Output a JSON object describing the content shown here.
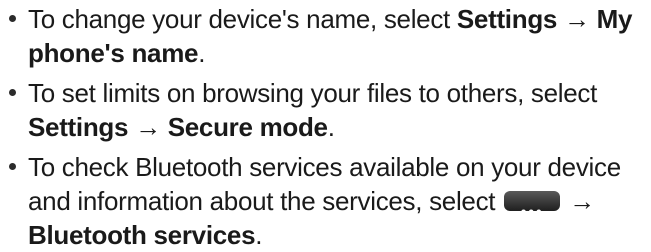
{
  "items": [
    {
      "intro": "To change your device's name, select ",
      "path_1": "Settings",
      "arrow_1": " → ",
      "path_2": "My phone's name",
      "end": "."
    },
    {
      "intro": "To set limits on browsing your files to others, select ",
      "path_1": "Settings",
      "arrow_1": " → ",
      "path_2": "Secure mode",
      "end": "."
    },
    {
      "intro": "To check Bluetooth services available on your device and information about the services, select ",
      "button_icon": "more-options-icon",
      "button_glyph": "•••",
      "arrow_1": " → ",
      "path_1": "Bluetooth services",
      "end": "."
    }
  ],
  "colors": {
    "text": "#1a1a1a",
    "button_bg": "#2e2e2e",
    "button_fg": "#ffffff"
  }
}
